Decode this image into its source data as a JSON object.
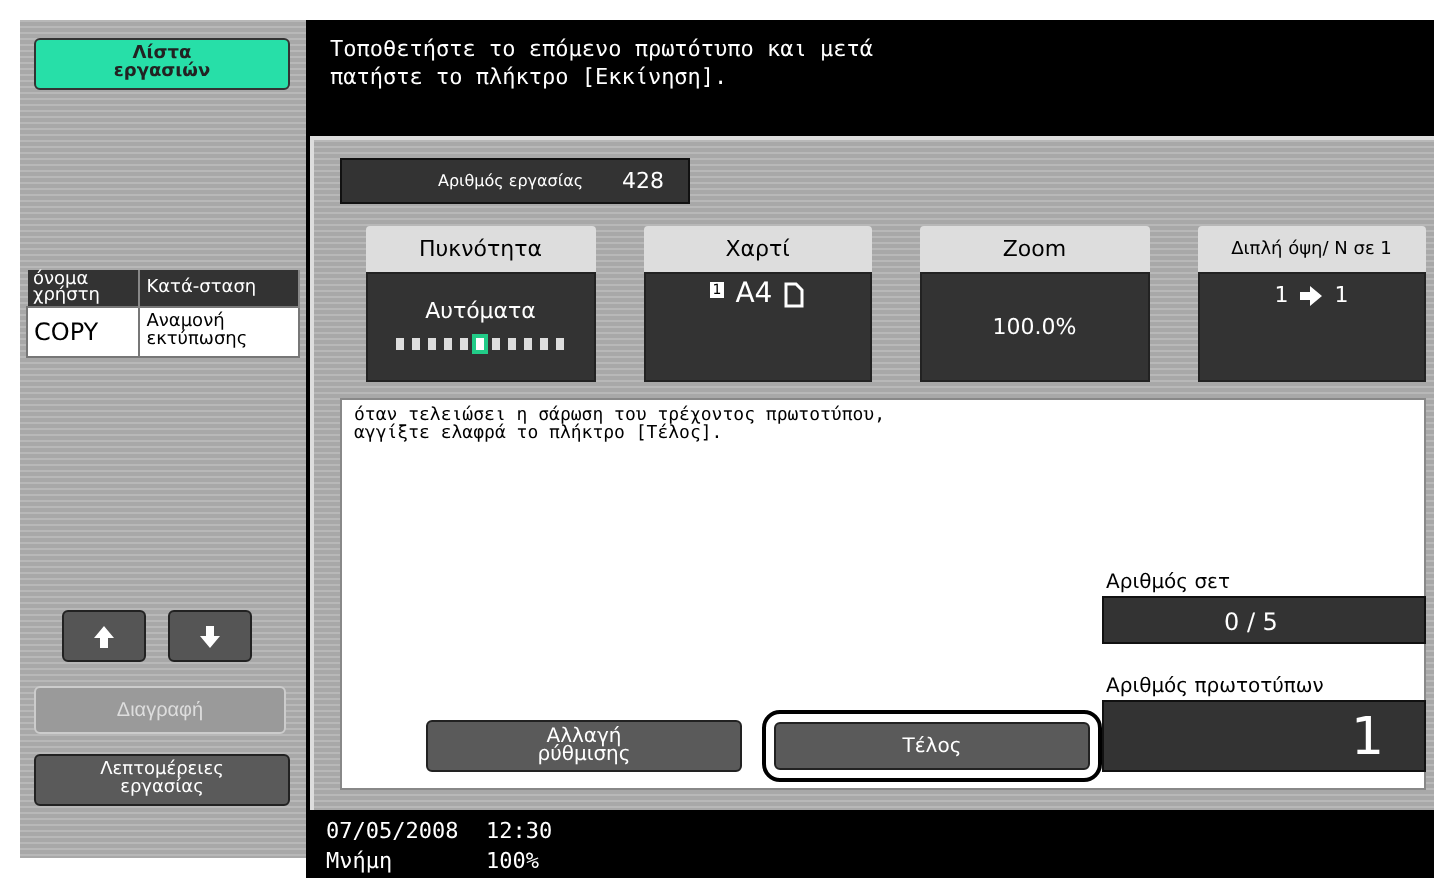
{
  "sidebar": {
    "job_list_button": "Λίστα εργασιών",
    "table": {
      "columns": [
        "όνομα χρήστη",
        "Κατά-σταση"
      ],
      "rows": [
        [
          "COPY",
          "Αναμονή εκτύπωσης"
        ]
      ]
    },
    "delete_button": {
      "label": "Διαγραφή",
      "disabled": true
    },
    "details_button": "Λεπτομέρειες εργασίας"
  },
  "header": {
    "message": "Τοποθετήστε το επόμενο πρωτότυπο και μετά πατήστε το πλήκτρο [Εκκίνηση]."
  },
  "job_number": {
    "label": "Αριθμός εργασίας",
    "value": "428"
  },
  "settings": [
    {
      "kind": "density",
      "title": "Πυκνότητα",
      "value": "Αυτόματα",
      "level": 0.5
    },
    {
      "kind": "paper",
      "title": "Χαρτί",
      "tray": "1",
      "value": "A4"
    },
    {
      "kind": "zoom",
      "title": "Zoom",
      "value": "100.0%"
    },
    {
      "kind": "duplex",
      "title": "Διπλή όψη/ Ν σε 1",
      "from": "1",
      "to": "1"
    }
  ],
  "message": "όταν τελειώσει η σάρωση του τρέχοντος πρωτοτύπου, αγγίξτε ελαφρά το πλήκτρο [Τέλος].",
  "counters": [
    {
      "label": "Αριθμός σετ",
      "value": "0 / 5",
      "kind": "sets"
    },
    {
      "label": "Αριθμός πρωτοτύπων",
      "value": "1",
      "kind": "originals"
    }
  ],
  "buttons": [
    {
      "label": "Αλλαγή ρύθμισης",
      "selected": false
    },
    {
      "label": "Τέλος",
      "selected": true
    }
  ],
  "status_bar": {
    "date": "07/05/2008",
    "time": "12:30",
    "memory_label": "Μνήμη",
    "memory_value": "100%"
  }
}
